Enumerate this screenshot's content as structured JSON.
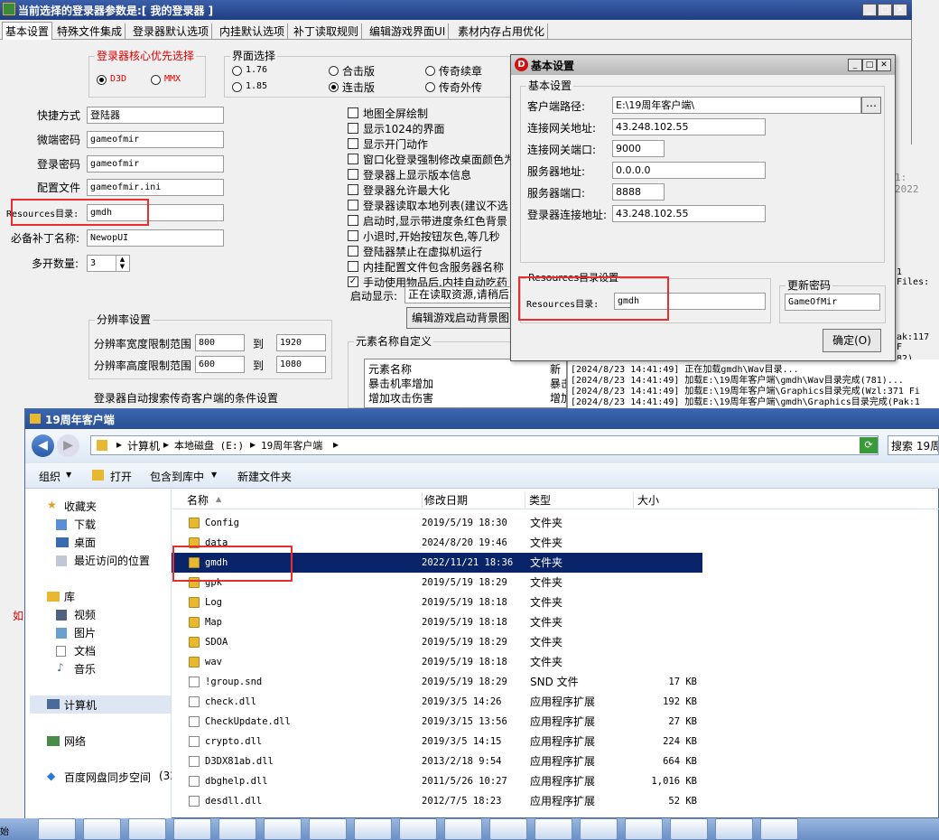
{
  "main": {
    "title": "当前选择的登录器参数是:[ 我的登录器 ]",
    "tabs": [
      "基本设置",
      "特殊文件集成",
      "登录器默认选项",
      "内挂默认选项",
      "补丁读取规则",
      "编辑游戏界面UI",
      "素材内存占用优化"
    ],
    "core": {
      "legend": "登录器核心优先选择",
      "d3d": "D3D",
      "mmx": "MMX"
    },
    "ui_select": {
      "legend": "界面选择",
      "opts": [
        "1.76",
        "合击版",
        "传奇续章",
        "1.85",
        "连击版",
        "传奇外传"
      ]
    },
    "fields": {
      "shortcut_label": "快捷方式",
      "shortcut": "登陆器",
      "micro_label": "微端密码",
      "micro": "gameofmir",
      "login_label": "登录密码",
      "login": "gameofmir",
      "config_label": "配置文件",
      "config": "gameofmir.ini",
      "res_label": "Resources目录:",
      "res": "gmdh",
      "patch_label": "必备补丁名称:",
      "patch": "NewopUI",
      "multi_label": "多开数量:",
      "multi": "3"
    },
    "checks": [
      "地图全屏绘制",
      "显示1024的界面",
      "显示开门动作",
      "窗口化登录强制修改桌面颜色为",
      "登录器上显示版本信息",
      "登录器允许最大化",
      "登录器读取本地列表(建议不选",
      "启动时,显示带进度条红色背景",
      "小退时,开始按钮灰色,等几秒",
      "登陆器禁止在虚拟机运行",
      "内挂配置文件包含服务器名称",
      "手动使用物品后,内挂自动吃药"
    ],
    "startup_label": "启动显示:",
    "startup_value": "正在读取资源,请稍后",
    "edit_bg_btn": "编辑游戏启动背景图",
    "elem": {
      "legend": "元素名称自定义",
      "head1": "元素名称",
      "head2": "新",
      "rows": [
        [
          "暴击机率增加",
          "暴击"
        ],
        [
          "增加攻击伤害",
          "增加"
        ]
      ]
    },
    "res": {
      "legend": "分辨率设置",
      "w_label": "分辨率宽度限制范围",
      "w_from": "800",
      "w_to": "1920",
      "h_label": "分辨率高度限制范围",
      "h_from": "600",
      "h_to": "1080",
      "to": "到"
    },
    "auto_search": "登录器自动搜索传奇客户端的条件设置",
    "right_fragment": "1: 2022",
    "right_files": "1 Files:",
    "right_pak": "ak:117 F",
    "right_82": "82)...",
    "side_char": "如"
  },
  "dialog": {
    "title": "基本设置",
    "group": "基本设置",
    "client_label": "客户端路径:",
    "client": "E:\\19周年客户端\\",
    "gw_addr_label": "连接网关地址:",
    "gw_addr": "43.248.102.55",
    "gw_port_label": "连接网关端口:",
    "gw_port": "9000",
    "srv_addr_label": "服务器地址:",
    "srv_addr": "0.0.0.0",
    "srv_port_label": "服务器端口:",
    "srv_port": "8888",
    "login_addr_label": "登录器连接地址:",
    "login_addr": "43.248.102.55",
    "res_group": "Resources目录设置",
    "res_label": "Resources目录:",
    "res": "gmdh",
    "pwd_group": "更新密码",
    "pwd": "GameOfMir",
    "ok": "确定(O)"
  },
  "log": [
    "[2024/8/23 14:41:49] 正在加载gmdh\\Wav目录...",
    "[2024/8/23 14:41:49] 加载E:\\19周年客户端\\gmdh\\Wav目录完成(781)...",
    "[2024/8/23 14:41:49] 加载E:\\19周年客户端\\Graphics目录完成(Wzl:371 Fi",
    "[2024/8/23 14:41:49] 加载E:\\19周年客户端\\gmdh\\Graphics目录完成(Pak:1"
  ],
  "explorer": {
    "title": "19周年客户端",
    "path": [
      "计算机",
      "本地磁盘 (E:)",
      "19周年客户端"
    ],
    "search": "搜索 19周",
    "toolbar": [
      "组织",
      "打开",
      "包含到库中",
      "新建文件夹"
    ],
    "nav": {
      "favorites": "收藏夹",
      "downloads": "下载",
      "desktop": "桌面",
      "recent": "最近访问的位置",
      "library": "库",
      "video": "视频",
      "pictures": "图片",
      "docs": "文档",
      "music": "音乐",
      "computer": "计算机",
      "network": "网络",
      "baidu": "百度网盘同步空间",
      "baidu_suffix": "(32"
    },
    "cols": [
      "名称",
      "修改日期",
      "类型",
      "大小"
    ],
    "rows": [
      [
        "Config",
        "2019/5/19 18:30",
        "文件夹",
        ""
      ],
      [
        "data",
        "2024/8/20 19:46",
        "文件夹",
        ""
      ],
      [
        "gmdh",
        "2022/11/21 18:36",
        "文件夹",
        ""
      ],
      [
        "gpk",
        "2019/5/19 18:29",
        "文件夹",
        ""
      ],
      [
        "Log",
        "2019/5/19 18:18",
        "文件夹",
        ""
      ],
      [
        "Map",
        "2019/5/19 18:18",
        "文件夹",
        ""
      ],
      [
        "SDOA",
        "2019/5/19 18:29",
        "文件夹",
        ""
      ],
      [
        "wav",
        "2019/5/19 18:18",
        "文件夹",
        ""
      ],
      [
        "!group.snd",
        "2019/5/19 18:29",
        "SND 文件",
        "17 KB"
      ],
      [
        "check.dll",
        "2019/3/5 14:26",
        "应用程序扩展",
        "192 KB"
      ],
      [
        "CheckUpdate.dll",
        "2019/3/15 13:56",
        "应用程序扩展",
        "27 KB"
      ],
      [
        "crypto.dll",
        "2019/3/5 14:15",
        "应用程序扩展",
        "224 KB"
      ],
      [
        "D3DX81ab.dll",
        "2013/2/18 9:54",
        "应用程序扩展",
        "664 KB"
      ],
      [
        "dbghelp.dll",
        "2011/5/26 10:27",
        "应用程序扩展",
        "1,016 KB"
      ],
      [
        "desdll.dll",
        "2012/7/5 18:23",
        "应用程序扩展",
        "52 KB"
      ]
    ]
  },
  "taskbar": {
    "start": "始"
  }
}
